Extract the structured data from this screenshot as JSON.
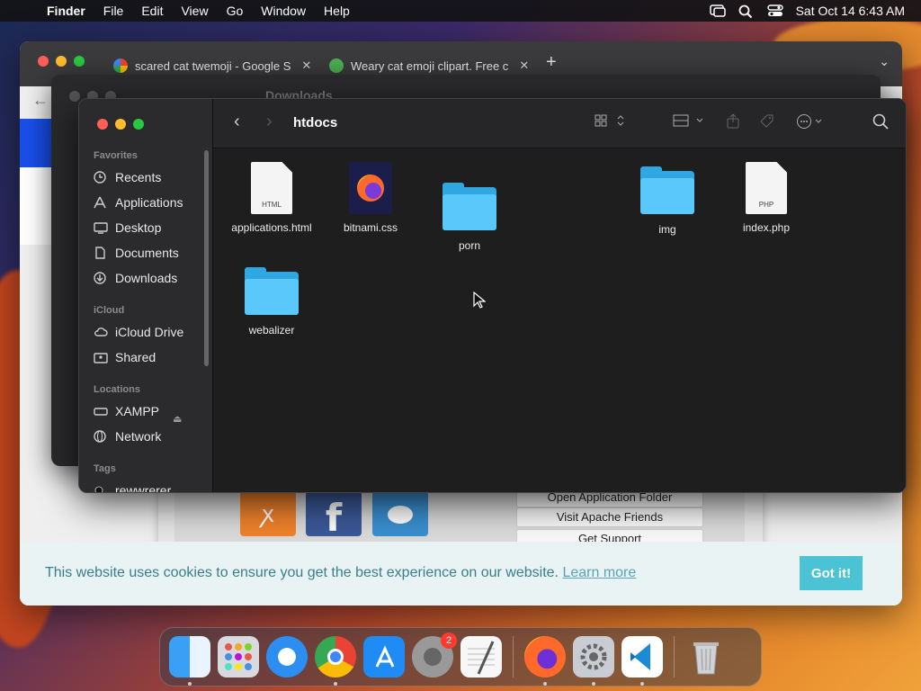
{
  "menubar": {
    "app": "Finder",
    "items": [
      "File",
      "Edit",
      "View",
      "Go",
      "Window",
      "Help"
    ],
    "clock": "Sat Oct 14  6:43 AM"
  },
  "browser": {
    "tabs": [
      {
        "title": "scared cat twemoji - Google S"
      },
      {
        "title": "Weary cat emoji clipart. Free c"
      }
    ],
    "xampp_buttons": [
      "Open Application Folder",
      "Visit Apache Friends",
      "Get Support"
    ],
    "cookie": {
      "text": "This website uses cookies to ensure you get the best experience on our website.",
      "link": "Learn more",
      "button": "Got it!"
    }
  },
  "finder_back": {
    "title": "Downloads"
  },
  "finder": {
    "title": "htdocs",
    "sidebar": {
      "favorites_label": "Favorites",
      "favorites": [
        "Recents",
        "Applications",
        "Desktop",
        "Documents",
        "Downloads"
      ],
      "icloud_label": "iCloud",
      "icloud": [
        "iCloud Drive",
        "Shared"
      ],
      "locations_label": "Locations",
      "locations": [
        "XAMPP",
        "Network"
      ],
      "tags_label": "Tags",
      "tags": [
        "rewwrerer"
      ]
    },
    "files": [
      {
        "name": "applications.html",
        "kind": "html",
        "tag": "HTML"
      },
      {
        "name": "bitnami.css",
        "kind": "css"
      },
      {
        "name": "porn",
        "kind": "folder"
      },
      {
        "name": "img",
        "kind": "folder"
      },
      {
        "name": "index.php",
        "kind": "php",
        "tag": "PHP"
      },
      {
        "name": "webalizer",
        "kind": "folder"
      }
    ]
  },
  "dock": {
    "apps": [
      "Finder",
      "Launchpad",
      "Safari",
      "Chrome",
      "App Store",
      "System Settings",
      "TextEdit",
      "Firefox",
      "System Preferences",
      "VS Code",
      "Trash"
    ],
    "settings_badge": "2"
  }
}
